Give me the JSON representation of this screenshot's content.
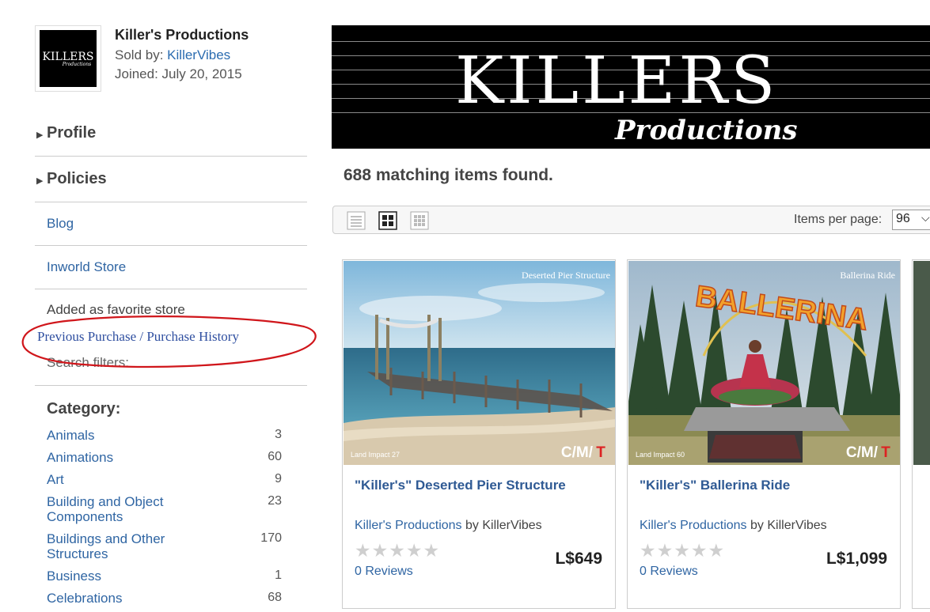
{
  "store": {
    "name": "Killer's Productions",
    "sold_by_label": "Sold by:",
    "seller": "KillerVibes",
    "joined": "Joined: July 20, 2015",
    "logo_line1": "KILLERS",
    "logo_line2": "Productions"
  },
  "sidebar": {
    "profile": "Profile",
    "policies": "Policies",
    "blog": "Blog",
    "inworld_store": "Inworld Store",
    "favorite": "Added as favorite store",
    "previous_purchase": "Previous Purchase / Purchase History",
    "search_filters": "Search filters:",
    "category_title": "Category:",
    "categories": [
      {
        "name": "Animals",
        "count": "3"
      },
      {
        "name": "Animations",
        "count": "60"
      },
      {
        "name": "Art",
        "count": "9"
      },
      {
        "name": "Building and Object Components",
        "count": "23"
      },
      {
        "name": "Buildings and Other Structures",
        "count": "170"
      },
      {
        "name": "Business",
        "count": "1"
      },
      {
        "name": "Celebrations",
        "count": "68"
      }
    ]
  },
  "banner": {
    "title": "KILLERS",
    "subtitle": "Productions"
  },
  "results": {
    "text": "688 matching items found."
  },
  "toolbar": {
    "per_page_label": "Items per page:",
    "per_page_value": "96",
    "views": [
      "list-view-icon",
      "grid-view-icon",
      "gallery-view-icon"
    ]
  },
  "products": [
    {
      "title": "\"Killer's\" Deserted Pier Structure",
      "image_label": "Deserted Pier Structure",
      "land_impact": "Land Impact 27",
      "perms": "C/M/",
      "perms_t": "T",
      "store": "Killer's Productions",
      "by": "by",
      "seller": "KillerVibes",
      "reviews": "0 Reviews",
      "price": "L$649"
    },
    {
      "title": "\"Killer's\" Ballerina Ride",
      "image_label": "Ballerina Ride",
      "image_sign": "BALLERINA",
      "land_impact": "Land Impact 60",
      "perms": "C/M/",
      "perms_t": "T",
      "store": "Killer's Productions",
      "by": "by",
      "seller": "KillerVibes",
      "reviews": "0 Reviews",
      "price": "L$1,099"
    }
  ],
  "colors": {
    "link": "#2f65a3",
    "annotation": "#d0161b",
    "banner_bg": "#000000"
  }
}
